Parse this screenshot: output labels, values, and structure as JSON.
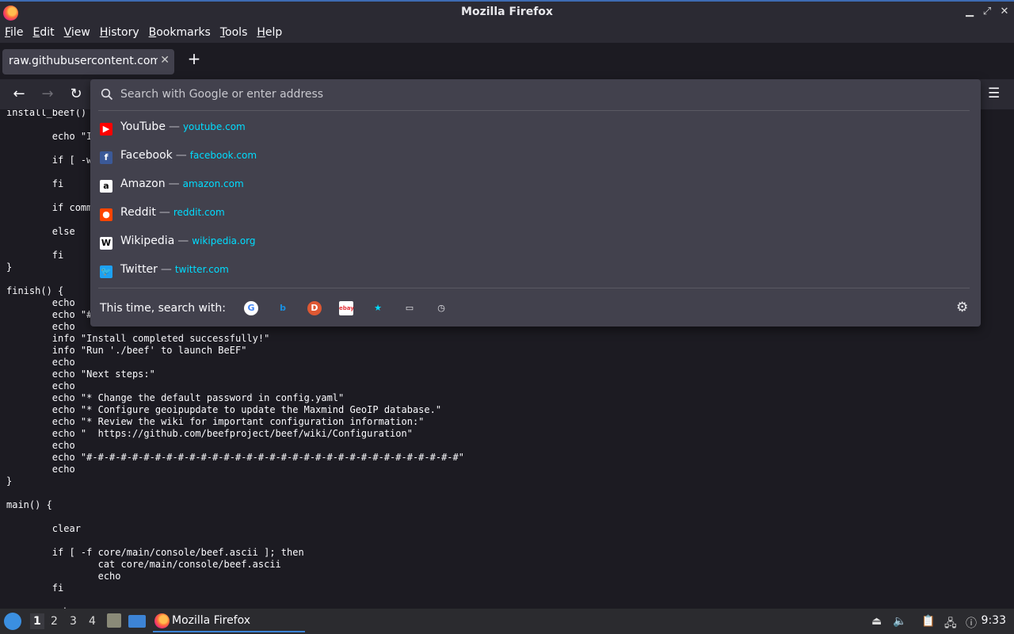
{
  "window": {
    "title": "Mozilla Firefox"
  },
  "menubar": [
    {
      "label": "File",
      "accel": "F",
      "rest": "ile"
    },
    {
      "label": "Edit",
      "accel": "E",
      "rest": "dit"
    },
    {
      "label": "View",
      "accel": "V",
      "rest": "iew"
    },
    {
      "label": "History",
      "accel": "H",
      "rest": "istory"
    },
    {
      "label": "Bookmarks",
      "accel": "B",
      "rest": "ookmarks"
    },
    {
      "label": "Tools",
      "accel": "T",
      "rest": "ools"
    },
    {
      "label": "Help",
      "accel": "H",
      "rest": "elp"
    }
  ],
  "tab": {
    "title": "raw.githubusercontent.com/b",
    "close": "✕"
  },
  "newtab": "+",
  "urlbar": {
    "placeholder": "Search with Google or enter address"
  },
  "suggestions": [
    {
      "name": "YouTube",
      "url": "youtube.com",
      "fav_color": "#ff0000",
      "fav_glyph": "▶"
    },
    {
      "name": "Facebook",
      "url": "facebook.com",
      "fav_color": "#3b5998",
      "fav_glyph": "f"
    },
    {
      "name": "Amazon",
      "url": "amazon.com",
      "fav_color": "#ffffff",
      "fav_glyph": "a"
    },
    {
      "name": "Reddit",
      "url": "reddit.com",
      "fav_color": "#ff4500",
      "fav_glyph": "●"
    },
    {
      "name": "Wikipedia",
      "url": "wikipedia.org",
      "fav_color": "#ffffff",
      "fav_glyph": "W"
    },
    {
      "name": "Twitter",
      "url": "twitter.com",
      "fav_color": "#1da1f2",
      "fav_glyph": "🐦"
    }
  ],
  "dash": "—",
  "searchwith": {
    "label": "This time, search with:"
  },
  "engines": [
    {
      "name": "google-icon",
      "glyph": "G"
    },
    {
      "name": "bing-icon",
      "glyph": "b"
    },
    {
      "name": "duckduckgo-icon",
      "glyph": "D"
    },
    {
      "name": "ebay-icon",
      "glyph": "ebay"
    },
    {
      "name": "bookmarks-icon",
      "glyph": "★"
    },
    {
      "name": "tabs-icon",
      "glyph": "▭"
    },
    {
      "name": "history-icon",
      "glyph": "◷"
    }
  ],
  "page_text": "install_beef() {\n\n        echo \"I\n\n        if [ -w\n\n        fi\n\n        if comm\n\n        else\n\n        fi\n}\n\nfinish() {\n        echo\n        echo \"#\n        echo\n        info \"Install completed successfully!\"\n        info \"Run './beef' to launch BeEF\"\n        echo\n        echo \"Next steps:\"\n        echo\n        echo \"* Change the default password in config.yaml\"\n        echo \"* Configure geoipupdate to update the Maxmind GeoIP database.\"\n        echo \"* Review the wiki for important configuration information:\"\n        echo \"  https://github.com/beefproject/beef/wiki/Configuration\"\n        echo\n        echo \"#-#-#-#-#-#-#-#-#-#-#-#-#-#-#-#-#-#-#-#-#-#-#-#-#-#-#-#-#-#-#-#-#\"\n        echo\n}\n\nmain() {\n\n        clear\n\n        if [ -f core/main/console/beef.ascii ]; then\n                cat core/main/console/beef.ascii\n                echo\n        fi\n\n        echo",
  "taskbar": {
    "workspaces": [
      "1",
      "2",
      "3",
      "4"
    ],
    "app_label": "Mozilla Firefox",
    "clock": "9:33"
  }
}
